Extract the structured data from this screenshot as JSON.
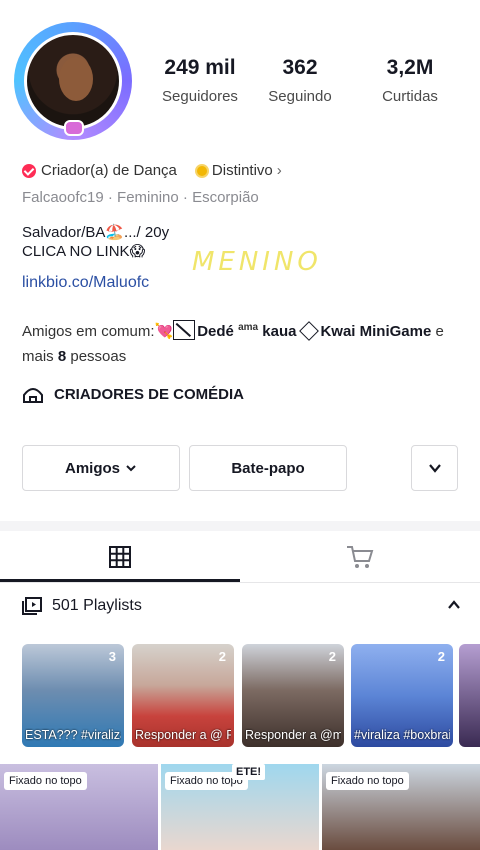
{
  "profile": {
    "stats": [
      {
        "value": "249 mil",
        "label": "Seguidores"
      },
      {
        "value": "362",
        "label": "Seguindo"
      },
      {
        "value": "3,2M",
        "label": "Curtidas"
      }
    ],
    "category_label": "Criador(a) de Dança",
    "distinct_label": "Distintivo",
    "distinct_chevron": "›",
    "meta": "Falcaoofc19 · Feminino · Escorpião",
    "bio_line1": "Salvador/BA🏖️.../ 20y",
    "bio_line2": "CLICA NO LINK😱",
    "link": "linkbio.co/Maluofc",
    "scribble": "MENINO",
    "friends_prefix": "Amigos em comum:💘",
    "friend1": "Dedé",
    "friend1_sup": "ama",
    "friend1_rest": "kaua",
    "friend2": "Kwai MiniGame",
    "friends_and": "e",
    "friends_more_prefix": "mais",
    "friends_more_count": "8",
    "friends_more_suffix": "pessoas",
    "creator_group": "CRIADORES DE COMÉDIA"
  },
  "buttons": {
    "friends": "Amigos",
    "chat": "Bate-papo",
    "chevron": "⌄"
  },
  "playlists": {
    "title": "501 Playlists",
    "items": [
      {
        "count": "3",
        "caption": "ESTA??? #viraliza #rab..."
      },
      {
        "count": "2",
        "caption": "Responder a @ Rafaela"
      },
      {
        "count": "2",
        "caption": "Responder a @malu_prof..."
      },
      {
        "count": "2",
        "caption": "#viraliza #boxbraids #..."
      }
    ]
  },
  "pinned": {
    "label": "Fixado no topo",
    "overlay": "ETE!"
  },
  "colors": {
    "accent_red": "#fe2c55",
    "link_blue": "#2b4fa3"
  }
}
